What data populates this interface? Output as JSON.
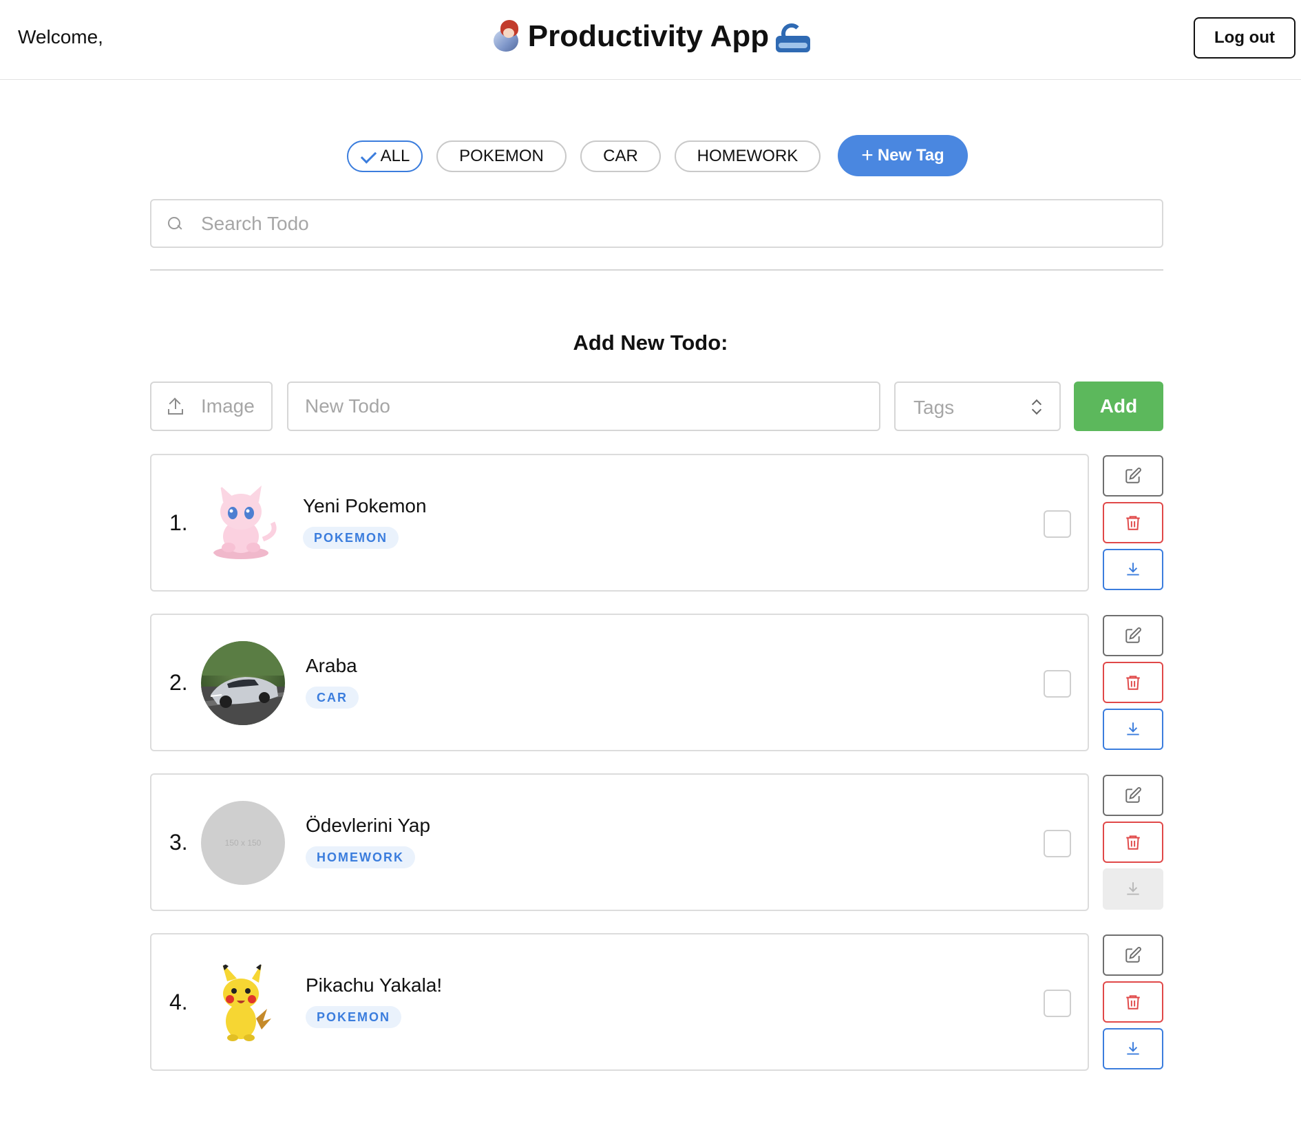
{
  "header": {
    "welcome": "Welcome,",
    "title": "Productivity App",
    "logout_label": "Log out"
  },
  "filters": {
    "tags": [
      {
        "label": "ALL",
        "selected": true
      },
      {
        "label": "POKEMON",
        "selected": false
      },
      {
        "label": "CAR",
        "selected": false
      },
      {
        "label": "HOMEWORK",
        "selected": false
      }
    ],
    "new_tag_label": "New Tag"
  },
  "search": {
    "placeholder": "Search Todo",
    "value": ""
  },
  "add_todo": {
    "heading": "Add New Todo:",
    "image_label": "Image",
    "todo_placeholder": "New Todo",
    "tags_placeholder": "Tags",
    "add_label": "Add"
  },
  "todos": [
    {
      "number": "1.",
      "title": "Yeni Pokemon",
      "tag": "POKEMON",
      "image": "mew",
      "done": false,
      "download_enabled": true
    },
    {
      "number": "2.",
      "title": "Araba",
      "tag": "CAR",
      "image": "car",
      "done": false,
      "download_enabled": true
    },
    {
      "number": "3.",
      "title": "Ödevlerini Yap",
      "tag": "HOMEWORK",
      "image": "placeholder",
      "placeholder_text": "150 x 150",
      "done": false,
      "download_enabled": false
    },
    {
      "number": "4.",
      "title": "Pikachu Yakala!",
      "tag": "POKEMON",
      "image": "pikachu",
      "done": false,
      "download_enabled": true
    }
  ],
  "colors": {
    "accent": "#4a87e0",
    "add_green": "#5cb85c",
    "delete_red": "#e04848",
    "badge_bg": "#eaf2fc"
  },
  "icons": {
    "edit": "pencil-square-icon",
    "delete": "trash-icon",
    "download": "download-icon",
    "search": "search-icon",
    "upload": "upload-icon"
  }
}
